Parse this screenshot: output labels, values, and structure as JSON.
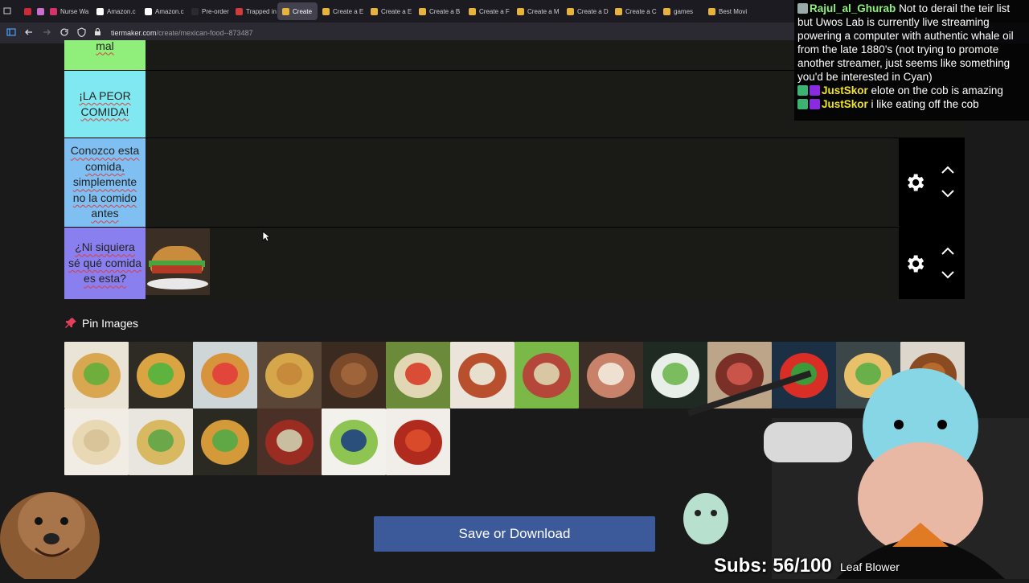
{
  "browser": {
    "tabs": [
      {
        "label": "",
        "color": "#cc2a36"
      },
      {
        "label": "",
        "color": "#c96fd0"
      },
      {
        "label": "Nurse Wa",
        "color": "#d6336c"
      },
      {
        "label": "Amazon.c",
        "color": "#ffffff"
      },
      {
        "label": "Amazon.c",
        "color": "#ffffff"
      },
      {
        "label": "Pre-order",
        "color": "#2b2a33"
      },
      {
        "label": "Trapped in",
        "color": "#d13b3b"
      },
      {
        "label": "Create",
        "color": "#e8b33a",
        "active": true
      },
      {
        "label": "Create a E",
        "color": "#e8b33a"
      },
      {
        "label": "Create a E",
        "color": "#e8b33a"
      },
      {
        "label": "Create a B",
        "color": "#e8b33a"
      },
      {
        "label": "Create a F",
        "color": "#e8b33a"
      },
      {
        "label": "Create a M",
        "color": "#e8b33a"
      },
      {
        "label": "Create a D",
        "color": "#e8b33a"
      },
      {
        "label": "Create a C",
        "color": "#e8b33a"
      },
      {
        "label": "games",
        "color": "#e8b33a"
      },
      {
        "label": "Best Movi",
        "color": "#e8b33a"
      }
    ],
    "url_host": "tiermaker.com",
    "url_path": "/create/mexican-food--873487"
  },
  "tiers": [
    {
      "label": "mal",
      "color": "#90ee7a"
    },
    {
      "label": "¡LA PEOR COMIDA!",
      "color": "#7fe8f0"
    },
    {
      "label": "Conozco esta comida, simplemente no la comido antes",
      "color": "#7fbff2"
    },
    {
      "label": "¿Ni siquiera sé qué comida es esta?",
      "color": "#8a7fee"
    }
  ],
  "pin_header": "Pin Images",
  "pool_images": [
    "tostadas",
    "tacos",
    "flautas",
    "gordita",
    "carnitas",
    "burrito",
    "sopa de tortilla",
    "frijoles charros",
    "carne asada",
    "caldo de res",
    "roast beef",
    "pico de gallo",
    "taco",
    "chili",
    "tortillas",
    "quesadilla",
    "sopes",
    "pozole",
    "guacamole",
    "salsa"
  ],
  "save_button": "Save or Download",
  "chat": [
    {
      "user": "Rajul_al_Ghurab",
      "msg": "Not to derail the teir list but Uwos Lab is currently live streaming powering a computer with authentic whale oil from the late 1880's (not trying to promote another streamer, just seems like something you'd be interested in Cyan)"
    },
    {
      "user": "JustSkor",
      "msg": "elote on the cob is amazing"
    },
    {
      "user": "JustSkor",
      "msg": "i like eating off the cob"
    }
  ],
  "overlay": {
    "subs": "Subs: 56/100",
    "goal": "Leaf Blower"
  }
}
